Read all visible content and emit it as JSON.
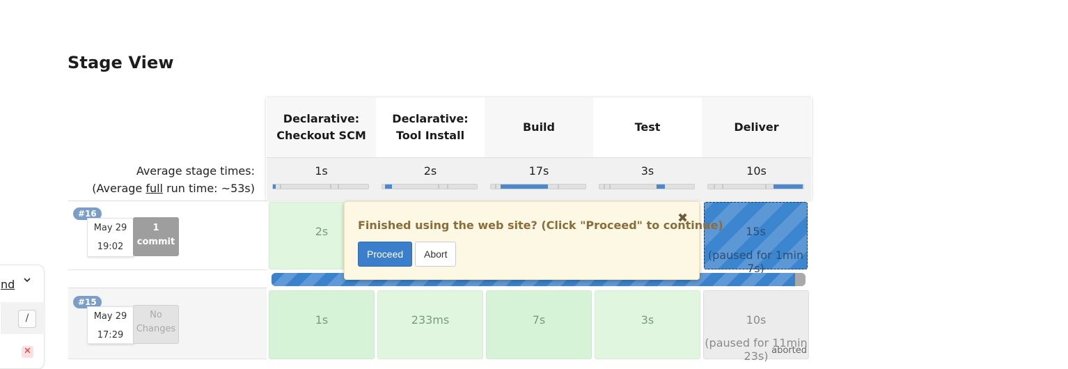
{
  "page": {
    "title": "Stage View"
  },
  "stages": [
    {
      "line1": "Declarative:",
      "line2": "Checkout SCM",
      "avg": "1s"
    },
    {
      "line1": "Declarative:",
      "line2": "Tool Install",
      "avg": "2s"
    },
    {
      "line1": "Build",
      "line2": "",
      "avg": "17s"
    },
    {
      "line1": "Test",
      "line2": "",
      "avg": "3s"
    },
    {
      "line1": "Deliver",
      "line2": "",
      "avg": "10s"
    }
  ],
  "averages": {
    "label": "Average stage times:",
    "full_prefix": "(Average ",
    "full_link": "full",
    "full_suffix": " run time: ~53s)"
  },
  "runs": [
    {
      "badge": "#16",
      "date": "May 29",
      "time": "19:02",
      "commit_count": "1",
      "commit_label": "commit",
      "cells": [
        "2s",
        "15s"
      ],
      "paused": "(paused for 1min 7s)"
    },
    {
      "badge": "#15",
      "date": "May 29",
      "time": "17:29",
      "changes_line1": "No",
      "changes_line2": "Changes",
      "cells": [
        "1s",
        "233ms",
        "7s",
        "3s",
        "10s"
      ],
      "paused": "(paused for 11min 23s)",
      "status": "aborted"
    }
  ],
  "progress": {
    "fraction": 0.98
  },
  "popup": {
    "message": "Finished using the web site? (Click \"Proceed\" to continue)",
    "proceed": "Proceed",
    "abort": "Abort",
    "close": "✖"
  },
  "side_panel": {
    "text": "nd",
    "slash": "/",
    "x": "✕"
  },
  "colors": {
    "accent": "#3b7fcc",
    "success_bg": "#d7f3d7",
    "paused_blue": "#4a88cf",
    "popup_bg": "#fdf8e3"
  },
  "icons": {
    "chevron": "chevron-down-icon",
    "close": "close-icon",
    "remove": "remove-icon"
  }
}
